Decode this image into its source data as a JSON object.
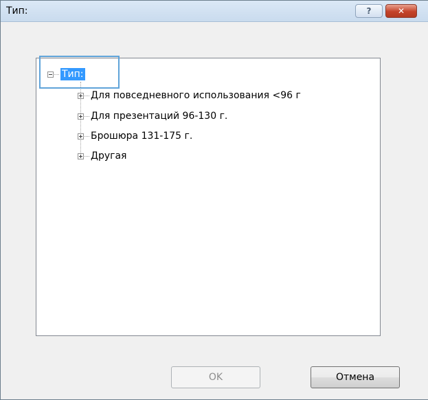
{
  "window": {
    "title": "Тип:",
    "help_icon": "question-icon",
    "help_label": "?",
    "close_icon": "close-icon",
    "close_label": "✕"
  },
  "tree": {
    "root": {
      "label": "Тип:",
      "expanded": true,
      "selected": true
    },
    "items": [
      {
        "label": "Для повседневного использования <96 г",
        "expanded": false
      },
      {
        "label": "Для презентаций 96-130 г.",
        "expanded": false
      },
      {
        "label": "Брошюра 131-175 г.",
        "expanded": false
      },
      {
        "label": "Другая",
        "expanded": false
      }
    ]
  },
  "buttons": {
    "ok_label": "OK",
    "ok_enabled": false,
    "cancel_label": "Отмена"
  },
  "colors": {
    "selection": "#3399ff",
    "focus": "#5fa3d9",
    "close_button": "#c4432a"
  }
}
